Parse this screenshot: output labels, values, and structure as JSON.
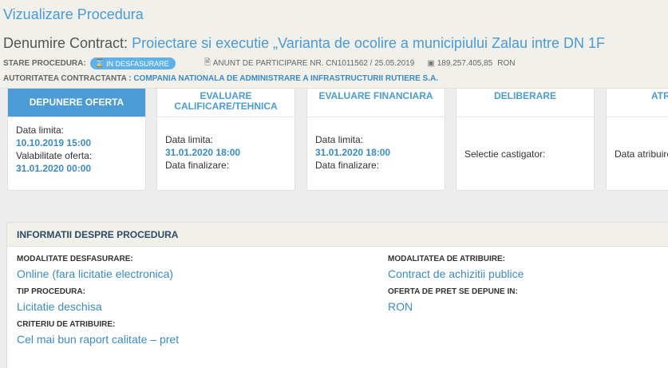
{
  "header": {
    "title": "Vizualizare Procedura",
    "contract_label": "Denumire Contract:",
    "contract_name": "Proiectare si executie „Varianta de ocolire a municipiului Zalau intre DN 1F",
    "status_label": "STARE PROCEDURA:",
    "status_badge": "IN DESFASURARE",
    "notice": "ANUNT DE PARTICIPARE NR. CN1011562 / 25.05.2019",
    "amount": "189.257.405,85",
    "currency": "RON",
    "authority_label": "AUTORITATEA CONTRACTANTA :",
    "authority_name": "COMPANIA NATIONALA DE ADMINISTRARE A INFRASTRUCTURII RUTIERE S.A."
  },
  "stages": [
    {
      "title": "DEPUNERE OFERTA",
      "l1": "Data limita:",
      "v1": "10.10.2019 15:00",
      "l2": "Valabilitate oferta:",
      "v2": "31.01.2020 00:00"
    },
    {
      "title": "EVALUARE CALIFICARE/TEHNICA",
      "l1": "Data limita:",
      "v1": "31.01.2020 18:00",
      "l2": "Data finalizare:"
    },
    {
      "title": "EVALUARE FINANCIARA",
      "l1": "Data limita:",
      "v1": "31.01.2020 18:00",
      "l2": "Data finalizare:"
    },
    {
      "title": "DELIBERARE",
      "l1": "Selectie castigator:"
    },
    {
      "title": "ATRIBUIRE",
      "l1": "Data atribuire:"
    }
  ],
  "info": {
    "title": "INFORMATII DESPRE PROCEDURA",
    "modalitate_label": "MODALITATE DESFASURARE:",
    "modalitate_value": "Online (fara licitatie electronica)",
    "tip_label": "TIP PROCEDURA:",
    "tip_value": "Licitatie deschisa",
    "criteriu_label": "CRITERIU DE ATRIBUIRE:",
    "criteriu_value": "Cel mai bun raport calitate – pret",
    "atribuire_label": "MODALITATEA DE ATRIBUIRE:",
    "atribuire_value": "Contract de achizitii publice",
    "oferta_label": "OFERTA DE PRET SE DEPUNE IN:",
    "oferta_value": "RON"
  },
  "colors": {
    "accent": "#4a9bd6",
    "badge": "#5fb2e8",
    "header_bg": "#f1f0ea"
  }
}
